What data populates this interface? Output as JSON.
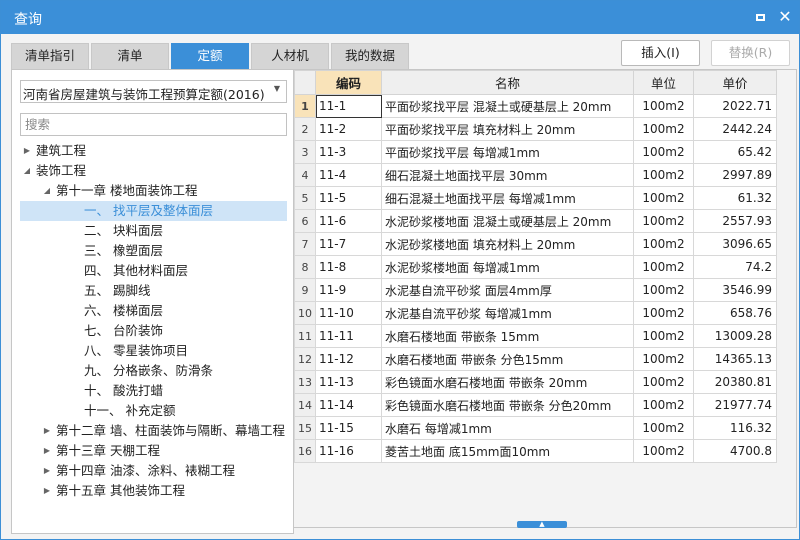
{
  "window": {
    "title": "查询",
    "maximize_icon": "maximize-icon",
    "close_icon": "close-icon",
    "close_glyph": "✕"
  },
  "tabs": [
    {
      "label": "清单指引",
      "active": false
    },
    {
      "label": "清单",
      "active": false
    },
    {
      "label": "定额",
      "active": true
    },
    {
      "label": "人材机",
      "active": false
    },
    {
      "label": "我的数据",
      "active": false
    }
  ],
  "actions": {
    "insert_label": "插入(I)",
    "replace_label": "替换(R)"
  },
  "left": {
    "selected_library": "河南省房屋建筑与装饰工程预算定额(2016)",
    "search_placeholder": "搜索",
    "tree": [
      {
        "label": "建筑工程",
        "level": 0,
        "expand": "collapsed"
      },
      {
        "label": "装饰工程",
        "level": 0,
        "expand": "expanded"
      },
      {
        "label": "第十一章 楼地面装饰工程",
        "level": 1,
        "expand": "expanded"
      },
      {
        "label": "一、 找平层及整体面层",
        "level": 2,
        "expand": "none",
        "selected": true
      },
      {
        "label": "二、 块料面层",
        "level": 2,
        "expand": "none"
      },
      {
        "label": "三、 橡塑面层",
        "level": 2,
        "expand": "none"
      },
      {
        "label": "四、 其他材料面层",
        "level": 2,
        "expand": "none"
      },
      {
        "label": "五、 踢脚线",
        "level": 2,
        "expand": "none"
      },
      {
        "label": "六、 楼梯面层",
        "level": 2,
        "expand": "none"
      },
      {
        "label": "七、 台阶装饰",
        "level": 2,
        "expand": "none"
      },
      {
        "label": "八、 零星装饰项目",
        "level": 2,
        "expand": "none"
      },
      {
        "label": "九、 分格嵌条、防滑条",
        "level": 2,
        "expand": "none"
      },
      {
        "label": "十、 酸洗打蜡",
        "level": 2,
        "expand": "none"
      },
      {
        "label": "十一、 补充定额",
        "level": 2,
        "expand": "none"
      },
      {
        "label": "第十二章 墙、柱面装饰与隔断、幕墙工程",
        "level": 1,
        "expand": "collapsed"
      },
      {
        "label": "第十三章 天棚工程",
        "level": 1,
        "expand": "collapsed"
      },
      {
        "label": "第十四章 油漆、涂料、裱糊工程",
        "level": 1,
        "expand": "collapsed"
      },
      {
        "label": "第十五章 其他装饰工程",
        "level": 1,
        "expand": "collapsed"
      }
    ]
  },
  "grid": {
    "columns": [
      "编码",
      "名称",
      "单位",
      "单价"
    ],
    "rows": [
      {
        "n": "1",
        "code": "11-1",
        "name": "平面砂浆找平层 混凝土或硬基层上 20mm",
        "unit": "100m2",
        "price": "2022.71"
      },
      {
        "n": "2",
        "code": "11-2",
        "name": "平面砂浆找平层 填充材料上 20mm",
        "unit": "100m2",
        "price": "2442.24"
      },
      {
        "n": "3",
        "code": "11-3",
        "name": "平面砂浆找平层 每增减1mm",
        "unit": "100m2",
        "price": "65.42"
      },
      {
        "n": "4",
        "code": "11-4",
        "name": "细石混凝土地面找平层 30mm",
        "unit": "100m2",
        "price": "2997.89"
      },
      {
        "n": "5",
        "code": "11-5",
        "name": "细石混凝土地面找平层 每增减1mm",
        "unit": "100m2",
        "price": "61.32"
      },
      {
        "n": "6",
        "code": "11-6",
        "name": "水泥砂浆楼地面 混凝土或硬基层上 20mm",
        "unit": "100m2",
        "price": "2557.93"
      },
      {
        "n": "7",
        "code": "11-7",
        "name": "水泥砂浆楼地面 填充材料上 20mm",
        "unit": "100m2",
        "price": "3096.65"
      },
      {
        "n": "8",
        "code": "11-8",
        "name": "水泥砂浆楼地面 每增减1mm",
        "unit": "100m2",
        "price": "74.2"
      },
      {
        "n": "9",
        "code": "11-9",
        "name": "水泥基自流平砂浆 面层4mm厚",
        "unit": "100m2",
        "price": "3546.99"
      },
      {
        "n": "10",
        "code": "11-10",
        "name": "水泥基自流平砂浆 每增减1mm",
        "unit": "100m2",
        "price": "658.76"
      },
      {
        "n": "11",
        "code": "11-11",
        "name": "水磨石楼地面 带嵌条 15mm",
        "unit": "100m2",
        "price": "13009.28"
      },
      {
        "n": "12",
        "code": "11-12",
        "name": "水磨石楼地面 带嵌条 分色15mm",
        "unit": "100m2",
        "price": "14365.13"
      },
      {
        "n": "13",
        "code": "11-13",
        "name": "彩色镜面水磨石楼地面 带嵌条 20mm",
        "unit": "100m2",
        "price": "20380.81"
      },
      {
        "n": "14",
        "code": "11-14",
        "name": "彩色镜面水磨石楼地面 带嵌条 分色20mm",
        "unit": "100m2",
        "price": "21977.74"
      },
      {
        "n": "15",
        "code": "11-15",
        "name": "水磨石 每增减1mm",
        "unit": "100m2",
        "price": "116.32"
      },
      {
        "n": "16",
        "code": "11-16",
        "name": "菱苦土地面 底15mm面10mm",
        "unit": "100m2",
        "price": "4700.8"
      }
    ]
  },
  "colors": {
    "accent": "#3b8fd8",
    "selected_header": "#f9e3b9",
    "tree_selected": "#cfe4f7"
  },
  "splitter": {
    "icon": "chevron-up-icon",
    "glyph": "▲"
  }
}
